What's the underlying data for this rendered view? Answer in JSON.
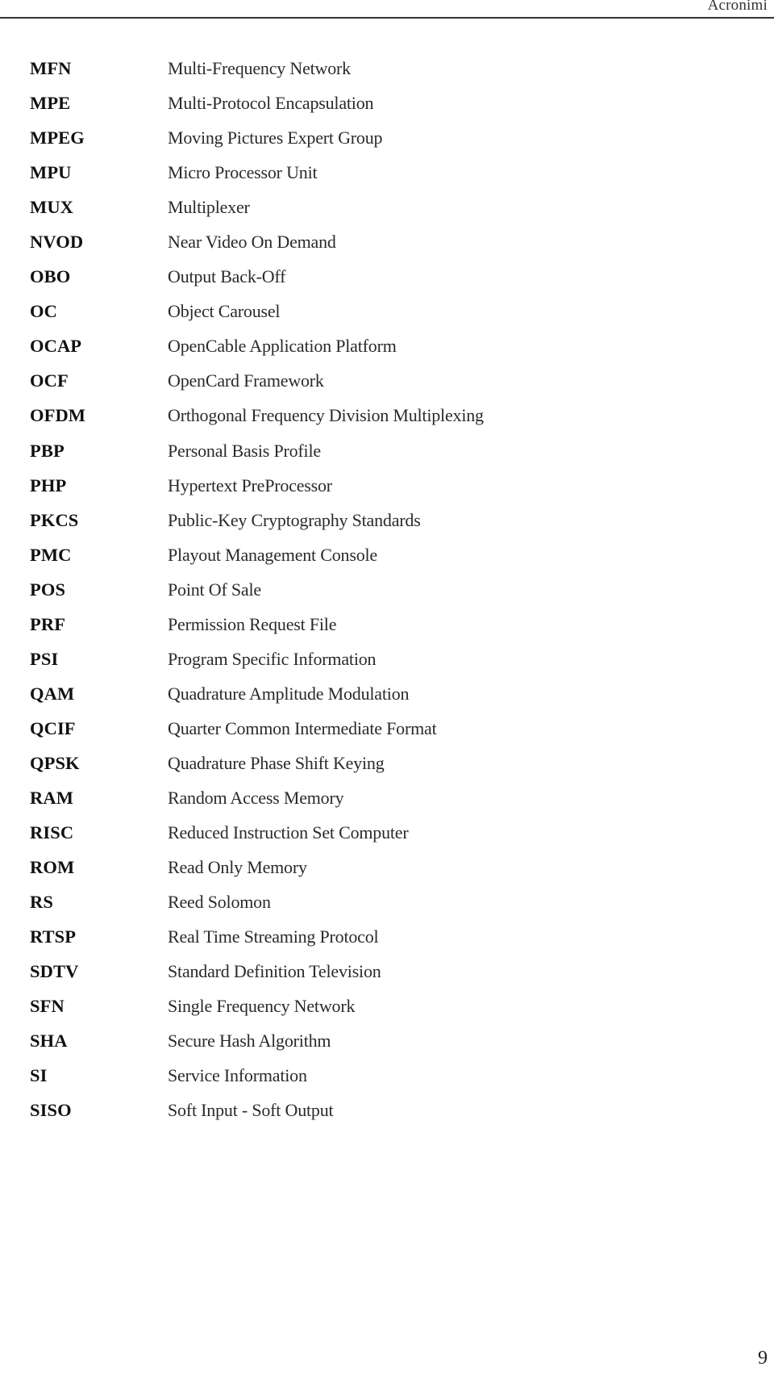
{
  "header": {
    "title": "Acronimi"
  },
  "acronyms": [
    {
      "abbr": "MFN",
      "definition": "Multi-Frequency Network"
    },
    {
      "abbr": "MPE",
      "definition": "Multi-Protocol Encapsulation"
    },
    {
      "abbr": "MPEG",
      "definition": "Moving Pictures Expert Group"
    },
    {
      "abbr": "MPU",
      "definition": "Micro Processor Unit"
    },
    {
      "abbr": "MUX",
      "definition": "Multiplexer"
    },
    {
      "abbr": "NVOD",
      "definition": "Near Video On Demand"
    },
    {
      "abbr": "OBO",
      "definition": "Output Back-Off"
    },
    {
      "abbr": "OC",
      "definition": "Object Carousel"
    },
    {
      "abbr": "OCAP",
      "definition": "OpenCable Application Platform"
    },
    {
      "abbr": "OCF",
      "definition": "OpenCard Framework"
    },
    {
      "abbr": "OFDM",
      "definition": "Orthogonal Frequency Division Multiplexing"
    },
    {
      "abbr": "PBP",
      "definition": "Personal Basis Profile"
    },
    {
      "abbr": "PHP",
      "definition": "Hypertext PreProcessor"
    },
    {
      "abbr": "PKCS",
      "definition": "Public-Key Cryptography Standards"
    },
    {
      "abbr": "PMC",
      "definition": "Playout Management Console"
    },
    {
      "abbr": "POS",
      "definition": "Point Of Sale"
    },
    {
      "abbr": "PRF",
      "definition": "Permission Request File"
    },
    {
      "abbr": "PSI",
      "definition": "Program Specific Information"
    },
    {
      "abbr": "QAM",
      "definition": "Quadrature Amplitude Modulation"
    },
    {
      "abbr": "QCIF",
      "definition": "Quarter Common Intermediate Format"
    },
    {
      "abbr": "QPSK",
      "definition": "Quadrature Phase Shift Keying"
    },
    {
      "abbr": "RAM",
      "definition": "Random Access Memory"
    },
    {
      "abbr": "RISC",
      "definition": "Reduced Instruction Set Computer"
    },
    {
      "abbr": "ROM",
      "definition": "Read Only Memory"
    },
    {
      "abbr": "RS",
      "definition": "Reed Solomon"
    },
    {
      "abbr": "RTSP",
      "definition": "Real Time Streaming Protocol"
    },
    {
      "abbr": "SDTV",
      "definition": "Standard Definition Television"
    },
    {
      "abbr": "SFN",
      "definition": "Single Frequency Network"
    },
    {
      "abbr": "SHA",
      "definition": "Secure Hash Algorithm"
    },
    {
      "abbr": "SI",
      "definition": "Service Information"
    },
    {
      "abbr": "SISO",
      "definition": "Soft Input - Soft Output"
    }
  ],
  "footer": {
    "page_number": "9"
  }
}
